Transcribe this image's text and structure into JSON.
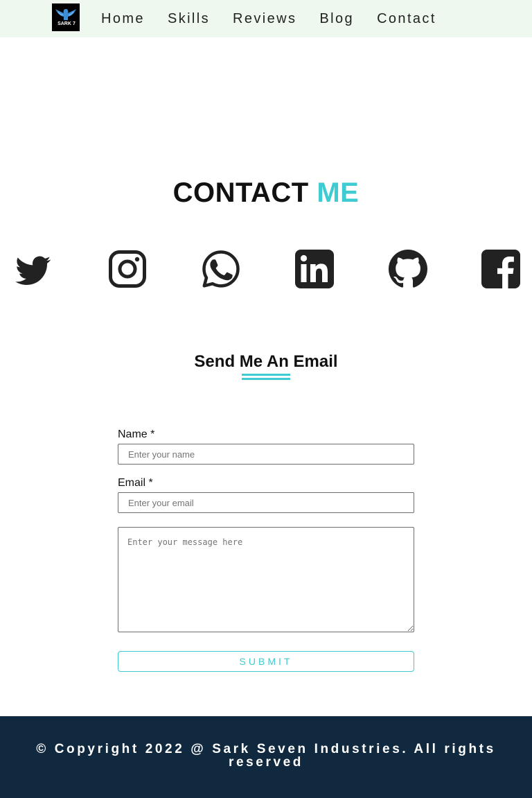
{
  "nav": {
    "logo_text": "SARK",
    "logo_mark": "7",
    "items": [
      {
        "label": "Home"
      },
      {
        "label": "Skills"
      },
      {
        "label": "Reviews"
      },
      {
        "label": "Blog"
      },
      {
        "label": "Contact"
      }
    ]
  },
  "contact": {
    "heading_main": "CONTACT",
    "heading_accent": "ME",
    "accent_color": "#3ecbd1"
  },
  "social": {
    "icons": [
      "twitter-icon",
      "instagram-icon",
      "whatsapp-icon",
      "linkedin-icon",
      "github-icon",
      "facebook-icon"
    ],
    "icon_color": "#222222"
  },
  "email_section": {
    "title": "Send Me An Email"
  },
  "form": {
    "name_label": "Name *",
    "name_placeholder": "Enter your name",
    "email_label": "Email *",
    "email_placeholder": "Enter your email",
    "message_placeholder": "Enter your message here",
    "submit_label": "SUBMIT"
  },
  "footer": {
    "copyright": "© Copyright 2022 @ Sark Seven Industries. All rights reserved",
    "background": "#11293f"
  }
}
